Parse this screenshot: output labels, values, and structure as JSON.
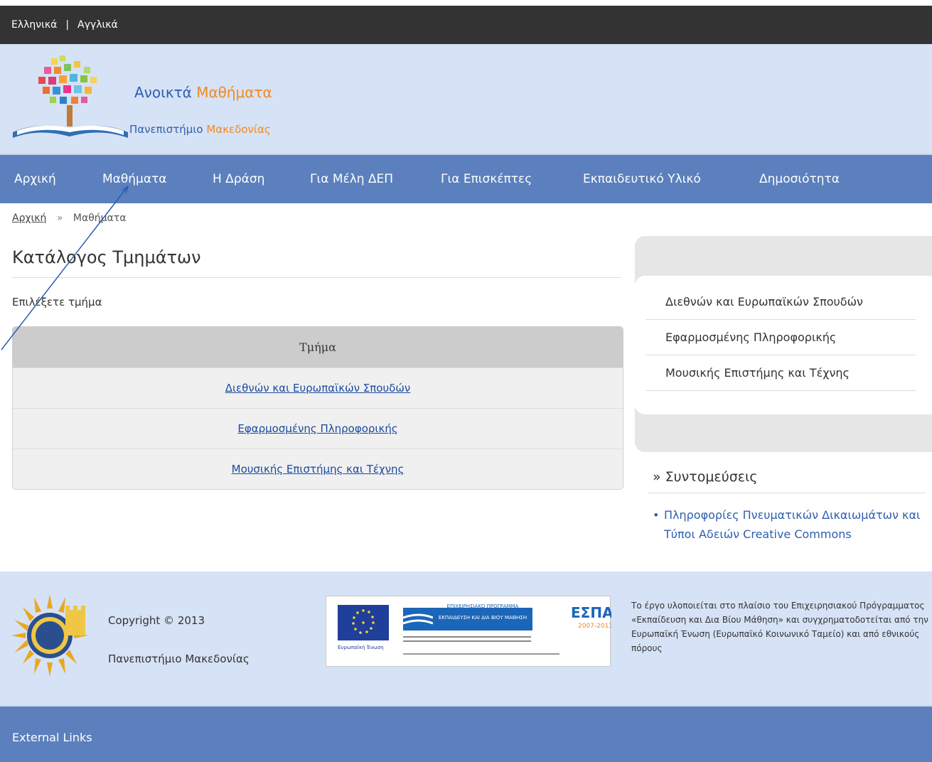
{
  "lang_bar": {
    "greek": "Ελληνικά",
    "separator": "|",
    "english": "Αγγλικά"
  },
  "header": {
    "title_main": "Ανοικτά",
    "title_accent": "Μαθήματα",
    "subtitle_main": "Πανεπιστήμιο",
    "subtitle_accent": "Μακεδονίας"
  },
  "nav": {
    "items": [
      "Αρχική",
      "Μαθήματα",
      "Η Δράση",
      "Για Μέλη ΔΕΠ",
      "Για Επισκέπτες",
      "Εκπαιδευτικό Υλικό",
      "Δημοσιότητα"
    ]
  },
  "breadcrumb": {
    "home": "Αρχική",
    "sep": "»",
    "current": "Μαθήματα"
  },
  "main": {
    "title": "Κατάλογος Τμημάτων",
    "instruction": "Επιλέξετε τμήμα",
    "table": {
      "header": "Τμήμα",
      "rows": [
        "Διεθνών και Ευρωπαϊκών Σπουδών",
        "Εφαρμοσμένης Πληροφορικής",
        "Μουσικής Επιστήμης και Τέχνης"
      ]
    }
  },
  "sidebar": {
    "links": [
      "Διεθνών και Ευρωπαϊκών Σπουδών",
      "Εφαρμοσμένης Πληροφορικής",
      "Μουσικής Επιστήμης και Τέχνης"
    ],
    "shortcuts_title": "» Συντομεύσεις",
    "shortcuts": [
      "Πληροφορίες Πνευματικών Δικαιωμάτων και Τύποι Αδειών Creative Commons"
    ]
  },
  "footer": {
    "copyright": "Copyright © 2013",
    "university": "Πανεπιστήμιο Μακεδονίας",
    "funding_text": "Το έργο υλοποιείται στο πλαίσιο του Επιχειρησιακού Πρόγραμματος «Εκπαίδευση και Δια Βίου Μάθηση» και συγχρηματοδοτείται από την Ευρωπαϊκή Ένωση (Ευρωπαϊκό Κοινωνικό Ταμείο) και από εθνικούς πόρους",
    "espa": {
      "program_line1": "ΕΠΙΧΕΙΡΗΣΙΑΚΟ ΠΡΟΓΡΑΜΜΑ",
      "program_line2": "ΕΚΠΑΙΔΕΥΣΗ ΚΑΙ ΔΙΑ ΒΙΟΥ ΜΑΘΗΣΗ",
      "espa_label": "ΕΣΠΑ",
      "espa_years": "2007-2013",
      "eu_label": "Ευρωπαϊκή Ένωση"
    },
    "external_links": "External Links"
  },
  "colors": {
    "nav_bg": "#5b80bd",
    "header_bg": "#d6e2f5",
    "top_bar_bg": "#333333",
    "brand_blue": "#2d5fb0",
    "brand_orange": "#f08a24"
  }
}
